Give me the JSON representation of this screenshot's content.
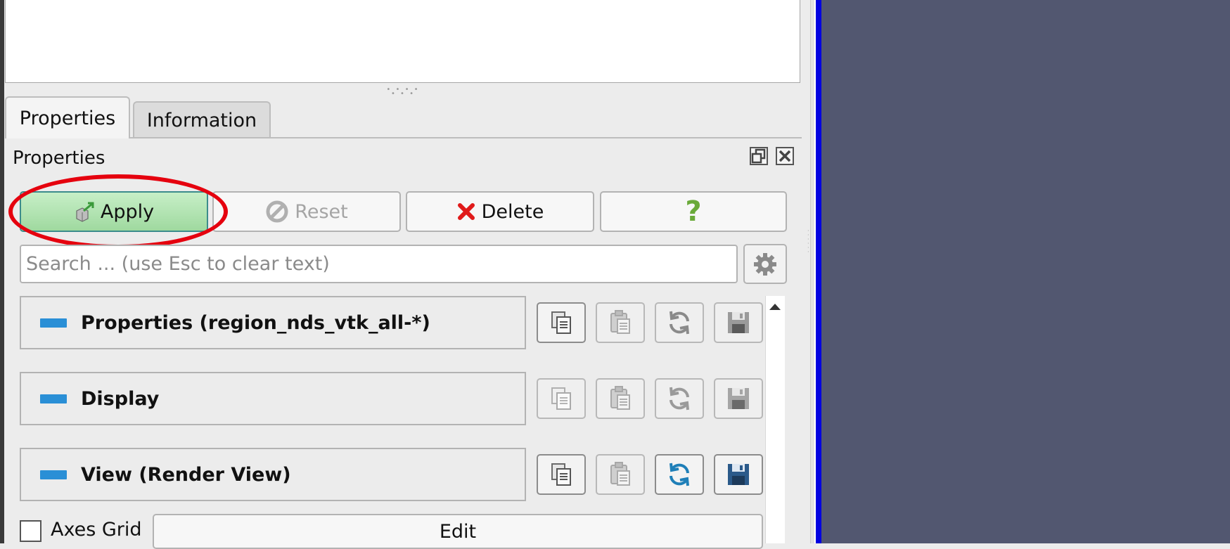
{
  "tabs": [
    {
      "label": "Properties",
      "active": true
    },
    {
      "label": "Information",
      "active": false
    }
  ],
  "dock": {
    "title": "Properties",
    "float_icon": "float-icon",
    "close_icon": "close-icon"
  },
  "actions": {
    "apply": "Apply",
    "reset": "Reset",
    "delete": "Delete",
    "help": "?"
  },
  "search": {
    "placeholder": "Search ... (use Esc to clear text)",
    "value": ""
  },
  "sections": [
    {
      "label": "Properties (region_nds_vtk_all-*)"
    },
    {
      "label": "Display"
    },
    {
      "label": "View (Render View)"
    }
  ],
  "axes_grid": {
    "label": "Axes Grid",
    "checked": false,
    "edit_label": "Edit"
  },
  "colors": {
    "apply_green": "#a8dfa8",
    "highlight_red": "#e5000e",
    "section_marker_blue": "#2a8fd6",
    "render_view_bg": "#525770",
    "view_border_blue": "#0000e0"
  }
}
